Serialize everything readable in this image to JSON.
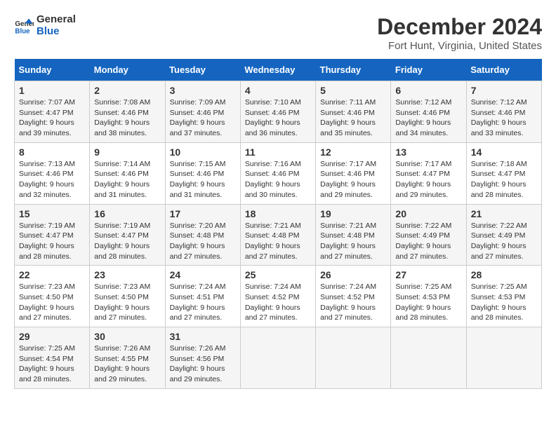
{
  "logo": {
    "line1": "General",
    "line2": "Blue"
  },
  "title": "December 2024",
  "subtitle": "Fort Hunt, Virginia, United States",
  "header": {
    "accent_color": "#1565c0"
  },
  "weekdays": [
    "Sunday",
    "Monday",
    "Tuesday",
    "Wednesday",
    "Thursday",
    "Friday",
    "Saturday"
  ],
  "weeks": [
    [
      {
        "day": "1",
        "sunrise": "7:07 AM",
        "sunset": "4:47 PM",
        "daylight": "9 hours and 39 minutes."
      },
      {
        "day": "2",
        "sunrise": "7:08 AM",
        "sunset": "4:46 PM",
        "daylight": "9 hours and 38 minutes."
      },
      {
        "day": "3",
        "sunrise": "7:09 AM",
        "sunset": "4:46 PM",
        "daylight": "9 hours and 37 minutes."
      },
      {
        "day": "4",
        "sunrise": "7:10 AM",
        "sunset": "4:46 PM",
        "daylight": "9 hours and 36 minutes."
      },
      {
        "day": "5",
        "sunrise": "7:11 AM",
        "sunset": "4:46 PM",
        "daylight": "9 hours and 35 minutes."
      },
      {
        "day": "6",
        "sunrise": "7:12 AM",
        "sunset": "4:46 PM",
        "daylight": "9 hours and 34 minutes."
      },
      {
        "day": "7",
        "sunrise": "7:12 AM",
        "sunset": "4:46 PM",
        "daylight": "9 hours and 33 minutes."
      }
    ],
    [
      {
        "day": "8",
        "sunrise": "7:13 AM",
        "sunset": "4:46 PM",
        "daylight": "9 hours and 32 minutes."
      },
      {
        "day": "9",
        "sunrise": "7:14 AM",
        "sunset": "4:46 PM",
        "daylight": "9 hours and 31 minutes."
      },
      {
        "day": "10",
        "sunrise": "7:15 AM",
        "sunset": "4:46 PM",
        "daylight": "9 hours and 31 minutes."
      },
      {
        "day": "11",
        "sunrise": "7:16 AM",
        "sunset": "4:46 PM",
        "daylight": "9 hours and 30 minutes."
      },
      {
        "day": "12",
        "sunrise": "7:17 AM",
        "sunset": "4:46 PM",
        "daylight": "9 hours and 29 minutes."
      },
      {
        "day": "13",
        "sunrise": "7:17 AM",
        "sunset": "4:47 PM",
        "daylight": "9 hours and 29 minutes."
      },
      {
        "day": "14",
        "sunrise": "7:18 AM",
        "sunset": "4:47 PM",
        "daylight": "9 hours and 28 minutes."
      }
    ],
    [
      {
        "day": "15",
        "sunrise": "7:19 AM",
        "sunset": "4:47 PM",
        "daylight": "9 hours and 28 minutes."
      },
      {
        "day": "16",
        "sunrise": "7:19 AM",
        "sunset": "4:47 PM",
        "daylight": "9 hours and 28 minutes."
      },
      {
        "day": "17",
        "sunrise": "7:20 AM",
        "sunset": "4:48 PM",
        "daylight": "9 hours and 27 minutes."
      },
      {
        "day": "18",
        "sunrise": "7:21 AM",
        "sunset": "4:48 PM",
        "daylight": "9 hours and 27 minutes."
      },
      {
        "day": "19",
        "sunrise": "7:21 AM",
        "sunset": "4:48 PM",
        "daylight": "9 hours and 27 minutes."
      },
      {
        "day": "20",
        "sunrise": "7:22 AM",
        "sunset": "4:49 PM",
        "daylight": "9 hours and 27 minutes."
      },
      {
        "day": "21",
        "sunrise": "7:22 AM",
        "sunset": "4:49 PM",
        "daylight": "9 hours and 27 minutes."
      }
    ],
    [
      {
        "day": "22",
        "sunrise": "7:23 AM",
        "sunset": "4:50 PM",
        "daylight": "9 hours and 27 minutes."
      },
      {
        "day": "23",
        "sunrise": "7:23 AM",
        "sunset": "4:50 PM",
        "daylight": "9 hours and 27 minutes."
      },
      {
        "day": "24",
        "sunrise": "7:24 AM",
        "sunset": "4:51 PM",
        "daylight": "9 hours and 27 minutes."
      },
      {
        "day": "25",
        "sunrise": "7:24 AM",
        "sunset": "4:52 PM",
        "daylight": "9 hours and 27 minutes."
      },
      {
        "day": "26",
        "sunrise": "7:24 AM",
        "sunset": "4:52 PM",
        "daylight": "9 hours and 27 minutes."
      },
      {
        "day": "27",
        "sunrise": "7:25 AM",
        "sunset": "4:53 PM",
        "daylight": "9 hours and 28 minutes."
      },
      {
        "day": "28",
        "sunrise": "7:25 AM",
        "sunset": "4:53 PM",
        "daylight": "9 hours and 28 minutes."
      }
    ],
    [
      {
        "day": "29",
        "sunrise": "7:25 AM",
        "sunset": "4:54 PM",
        "daylight": "9 hours and 28 minutes."
      },
      {
        "day": "30",
        "sunrise": "7:26 AM",
        "sunset": "4:55 PM",
        "daylight": "9 hours and 29 minutes."
      },
      {
        "day": "31",
        "sunrise": "7:26 AM",
        "sunset": "4:56 PM",
        "daylight": "9 hours and 29 minutes."
      },
      null,
      null,
      null,
      null
    ]
  ],
  "labels": {
    "sunrise": "Sunrise:",
    "sunset": "Sunset:",
    "daylight": "Daylight:"
  }
}
